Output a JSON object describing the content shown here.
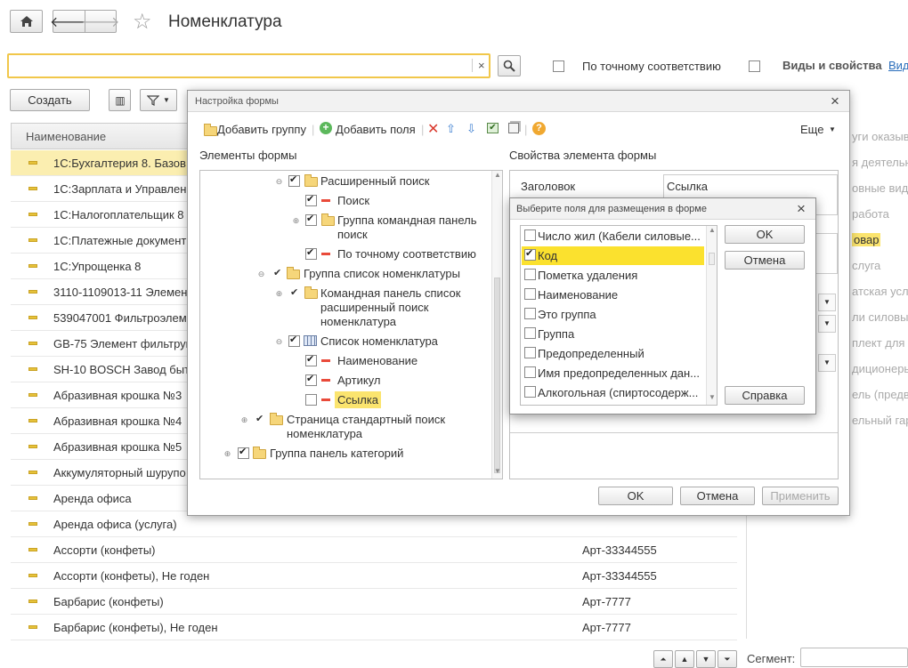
{
  "page": {
    "title": "Номенклатура"
  },
  "toolbar": {
    "search_value": "",
    "exact_match_label": "По точному соответствию",
    "kinds_label": "Виды и свойства",
    "kinds_link": "Вид",
    "create_label": "Создать"
  },
  "table": {
    "header": "Наименование",
    "rows": [
      {
        "name": "1С:Бухгалтерия 8. Базов",
        "art": ""
      },
      {
        "name": "1С:Зарплата и Управлени",
        "art": ""
      },
      {
        "name": "1С:Налогоплательщик 8",
        "art": ""
      },
      {
        "name": "1С:Платежные документ",
        "art": ""
      },
      {
        "name": "1С:Упрощенка 8",
        "art": ""
      },
      {
        "name": "3110-1109013-11 Элемент",
        "art": ""
      },
      {
        "name": "539047001 Фильтроэлеме",
        "art": ""
      },
      {
        "name": "GB-75 Элемент фильтрун",
        "art": ""
      },
      {
        "name": "SH-10 BOSCH Завод быт",
        "art": ""
      },
      {
        "name": "Абразивная крошка №3",
        "art": ""
      },
      {
        "name": "Абразивная крошка №4",
        "art": ""
      },
      {
        "name": "Абразивная крошка №5",
        "art": ""
      },
      {
        "name": "Аккумуляторный шурупо",
        "art": ""
      },
      {
        "name": "Аренда офиса",
        "art": ""
      },
      {
        "name": "Аренда офиса (услуга)",
        "art": ""
      },
      {
        "name": "Ассорти (конфеты)",
        "art": "Арт-33344555"
      },
      {
        "name": "Ассорти (конфеты), Не годен",
        "art": "Арт-33344555"
      },
      {
        "name": "Барбарис (конфеты)",
        "art": "Арт-7777"
      },
      {
        "name": "Барбарис (конфеты), Не годен",
        "art": "Арт-7777"
      }
    ]
  },
  "right_panel": {
    "items": [
      "уги оказыва",
      "я деятельн",
      "овные виды",
      "работа",
      "овар",
      "слуга",
      "атская услу",
      "ли силовы",
      "плект для к",
      "диционеры",
      "ель (предв",
      "ельный гар"
    ],
    "segment_label": "Сегмент:"
  },
  "form_dialog": {
    "title": "Настройка формы",
    "add_group": "Добавить группу",
    "add_fields": "Добавить поля",
    "more": "Еще",
    "elements_title": "Элементы формы",
    "props_title": "Свойства элемента формы",
    "tree": [
      {
        "label": "Расширенный поиск"
      },
      {
        "label": "Поиск"
      },
      {
        "label": "Группа командная панель"
      },
      {
        "label": "поиск"
      },
      {
        "label": "По точному соответствию"
      },
      {
        "label": "Группа список номенклатуры"
      },
      {
        "label": "Командная панель список"
      },
      {
        "label": "расширенный поиск"
      },
      {
        "label": "номенклатура"
      },
      {
        "label": "Список номенклатура"
      },
      {
        "label": "Наименование"
      },
      {
        "label": "Артикул"
      },
      {
        "label": "Ссылка"
      },
      {
        "label": "Страница стандартный поиск"
      },
      {
        "label": "номенклатура"
      },
      {
        "label": "Группа панель категорий"
      }
    ],
    "prop_label": "Заголовок",
    "prop_value": "Ссылка",
    "ok": "OK",
    "cancel": "Отмена",
    "apply": "Применить"
  },
  "fields_dialog": {
    "title": "Выберите поля для размещения в форме",
    "items": [
      {
        "label": "Число жил (Кабели силовые...",
        "checked": false
      },
      {
        "label": "Код",
        "checked": true
      },
      {
        "label": "Пометка удаления",
        "checked": false
      },
      {
        "label": "Наименование",
        "checked": false
      },
      {
        "label": "Это группа",
        "checked": false
      },
      {
        "label": "Группа",
        "checked": false
      },
      {
        "label": "Предопределенный",
        "checked": false
      },
      {
        "label": "Имя предопределенных дан...",
        "checked": false
      },
      {
        "label": "Алкогольная (спиртосодерж...",
        "checked": false
      }
    ],
    "ok": "OK",
    "cancel": "Отмена",
    "help": "Справка"
  }
}
